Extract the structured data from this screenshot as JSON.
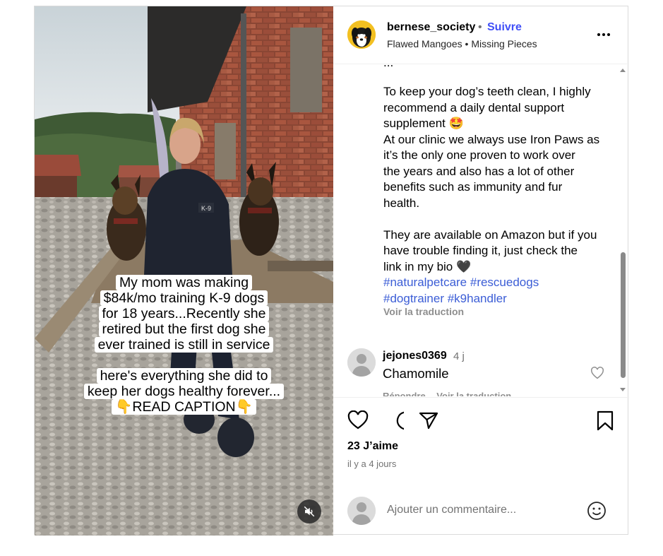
{
  "media": {
    "overlay_block_1": [
      "My mom was making",
      "$84k/mo training K-9 dogs",
      "for 18 years...Recently she",
      "retired but the first dog she",
      "ever trained is still in service"
    ],
    "overlay_block_2": [
      "here's everything she did to",
      "keep her dogs healthy forever...",
      "👇READ CAPTION👇"
    ],
    "vest_patch": "K-9",
    "mute_icon": "speaker-muted-icon"
  },
  "header": {
    "username": "bernese_society",
    "separator": "•",
    "follow_label": "Suivre",
    "audio_artist": "Flawed Mangoes",
    "audio_separator": "•",
    "audio_title": "Missing Pieces"
  },
  "caption": {
    "partial_top": "...",
    "paragraph_1": [
      "To keep your dog’s teeth clean, I highly",
      "recommend a daily dental support",
      "supplement 🤩",
      "At our clinic we always use Iron Paws as",
      "it’s the only one proven to work over",
      "the years and also has a lot of other",
      "benefits such as immunity and fur",
      "health."
    ],
    "paragraph_2": [
      "They are available on Amazon but if you",
      "have trouble finding it, just check the",
      "link in my bio 🖤"
    ],
    "hashtags_line_1": "#naturalpetcare #rescuedogs",
    "hashtags_line_2": "#dogtrainer #k9handler",
    "translate_label": "Voir la traduction"
  },
  "comment": {
    "username": "jejones0369",
    "time": "4 j",
    "text": "Chamomile",
    "reply_label": "Répondre",
    "translate_label": "Voir la traduction"
  },
  "actions": {
    "icons": [
      "heart-icon",
      "comment-icon",
      "share-icon",
      "bookmark-icon"
    ]
  },
  "stats": {
    "likes": "23 J’aime",
    "date": "il y a 4 jours"
  },
  "add_comment": {
    "placeholder": "Ajouter un commentaire..."
  },
  "colors": {
    "follow": "#4150f7",
    "hashtag": "#3b5dd6",
    "muted_text": "#737373",
    "border": "#dbdbdb"
  }
}
